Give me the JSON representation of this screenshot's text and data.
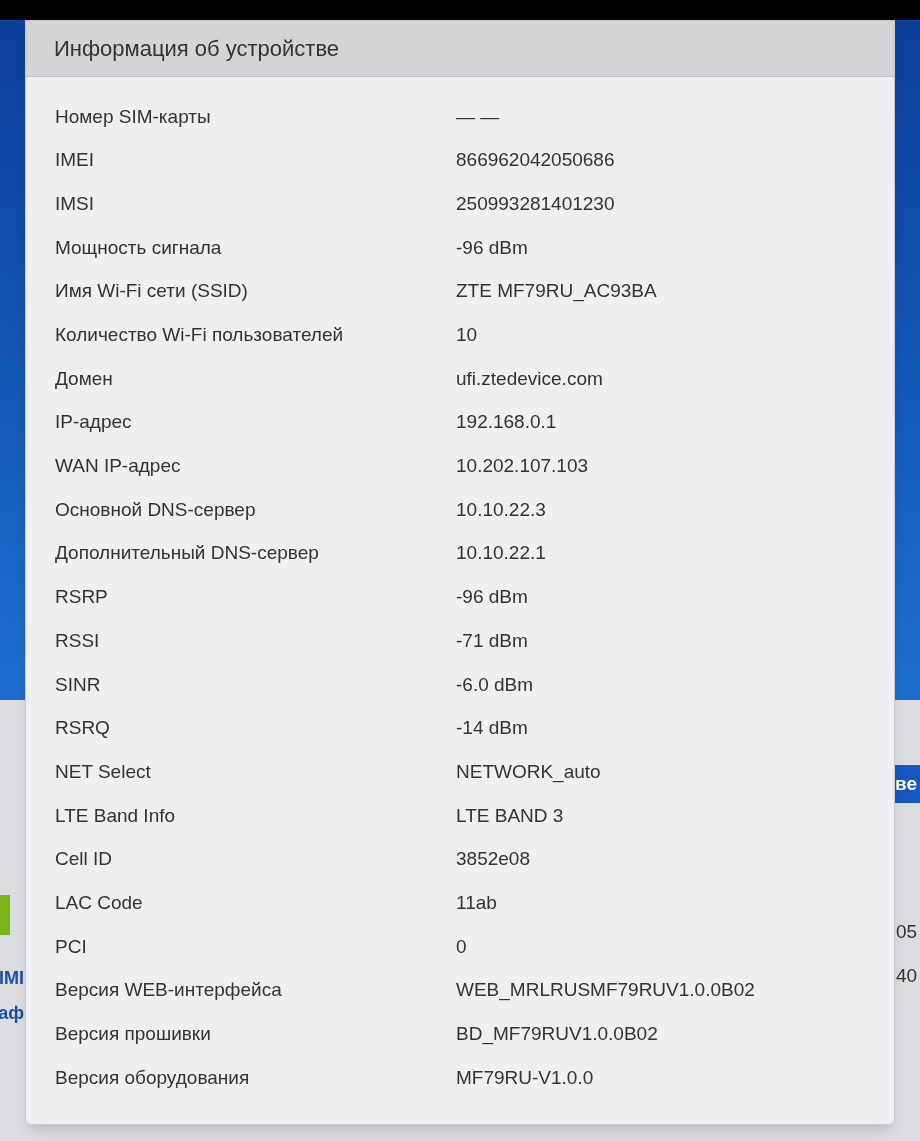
{
  "background": {
    "button": "ве",
    "texts": [
      {
        "text": "IMI",
        "kind": "link"
      },
      {
        "text": "аф",
        "kind": "link"
      },
      {
        "text": "05",
        "kind": "plain"
      },
      {
        "text": "40",
        "kind": "plain"
      }
    ]
  },
  "dialog": {
    "title": "Информация об устройстве",
    "rows": [
      {
        "label": "Номер SIM-карты",
        "value": "— —"
      },
      {
        "label": "IMEI",
        "value": "866962042050686"
      },
      {
        "label": "IMSI",
        "value": "250993281401230"
      },
      {
        "label": "Мощность сигнала",
        "value": "-96 dBm"
      },
      {
        "label": "Имя Wi-Fi сети (SSID)",
        "value": "ZTE MF79RU_AC93BA"
      },
      {
        "label": "Количество Wi-Fi пользователей",
        "value": "10"
      },
      {
        "label": "Домен",
        "value": "ufi.ztedevice.com"
      },
      {
        "label": "IP-адрес",
        "value": "192.168.0.1"
      },
      {
        "label": "WAN IP-адрес",
        "value": "10.202.107.103"
      },
      {
        "label": "Основной DNS-сервер",
        "value": "10.10.22.3"
      },
      {
        "label": "Дополнительный DNS-сервер",
        "value": "10.10.22.1"
      },
      {
        "label": "RSRP",
        "value": "-96 dBm"
      },
      {
        "label": "RSSI",
        "value": "-71 dBm"
      },
      {
        "label": "SINR",
        "value": "-6.0 dBm"
      },
      {
        "label": "RSRQ",
        "value": "-14 dBm"
      },
      {
        "label": "NET Select",
        "value": "NETWORK_auto"
      },
      {
        "label": "LTE Band Info",
        "value": "LTE BAND 3"
      },
      {
        "label": "Cell ID",
        "value": "3852e08"
      },
      {
        "label": "LAC Code",
        "value": "11ab"
      },
      {
        "label": "PCI",
        "value": "0"
      },
      {
        "label": "Версия WEB-интерфейса",
        "value": "WEB_MRLRUSMF79RUV1.0.0B02"
      },
      {
        "label": "Версия прошивки",
        "value": "BD_MF79RUV1.0.0B02"
      },
      {
        "label": "Версия оборудования",
        "value": "MF79RU-V1.0.0"
      }
    ]
  }
}
